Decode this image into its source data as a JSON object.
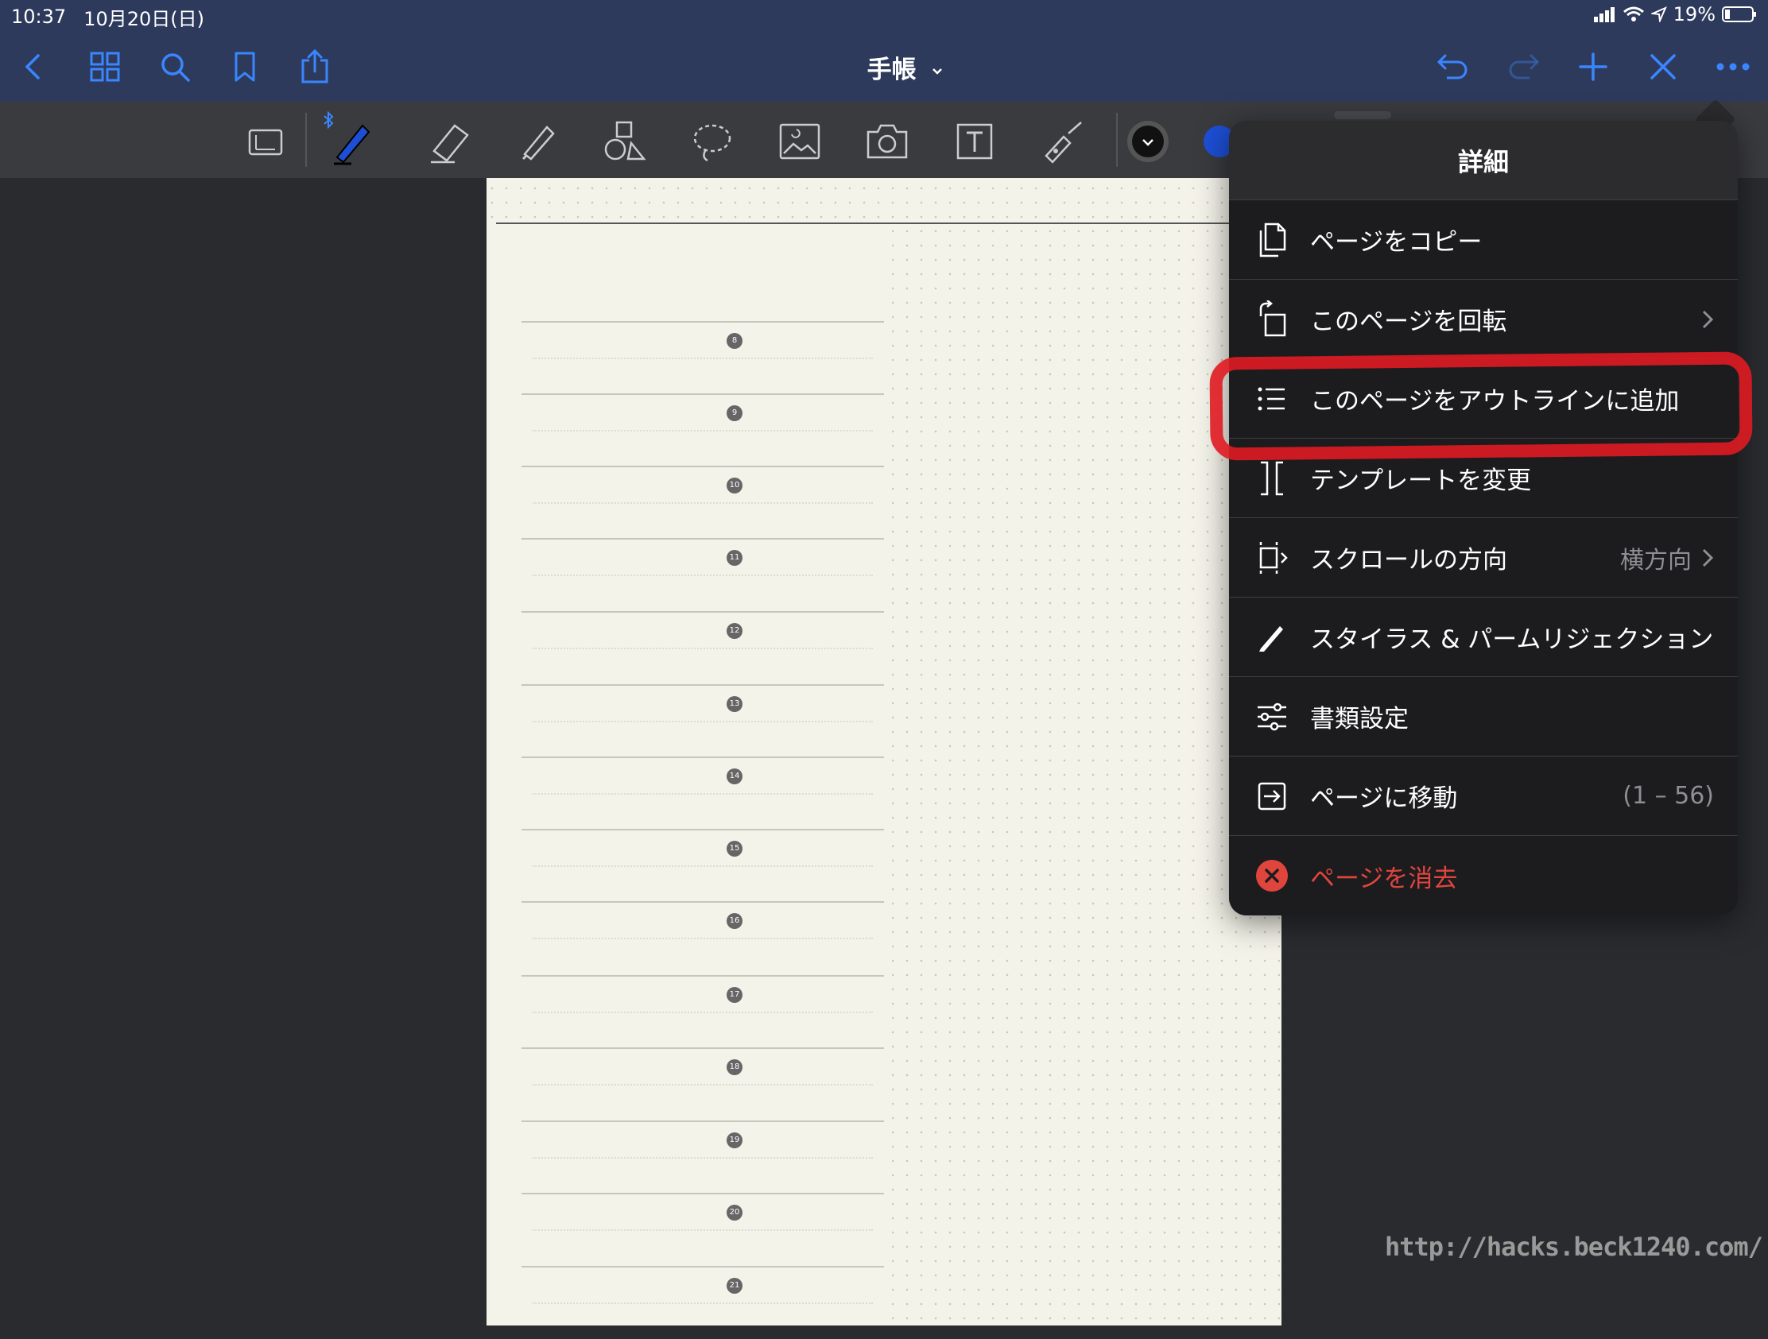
{
  "status": {
    "time": "10:37",
    "date": "10月20日(日)",
    "battery": "19%"
  },
  "topbar": {
    "title": "手帳",
    "accent": "#3a86ff"
  },
  "page": {
    "hours": [
      "8",
      "9",
      "10",
      "11",
      "12",
      "13",
      "14",
      "15",
      "16",
      "17",
      "18",
      "19",
      "20",
      "21"
    ]
  },
  "popover": {
    "title": "詳細",
    "items": [
      {
        "label": "ページをコピー",
        "icon": "copy-icon"
      },
      {
        "label": "このページを回転",
        "icon": "rotate-icon",
        "chevron": true
      },
      {
        "label": "このページをアウトラインに追加",
        "icon": "outline-list-icon"
      },
      {
        "label": "テンプレートを変更",
        "icon": "template-icon"
      },
      {
        "label": "スクロールの方向",
        "icon": "scroll-direction-icon",
        "value": "横方向",
        "chevron": true
      },
      {
        "label": "スタイラス & パームリジェクション",
        "icon": "pencil-icon"
      },
      {
        "label": "書類設定",
        "icon": "sliders-icon"
      },
      {
        "label": "ページに移動",
        "icon": "go-to-page-icon",
        "value": "(1 – 56)"
      },
      {
        "label": "ページを消去",
        "icon": "delete-icon",
        "destructive": true
      }
    ]
  },
  "watermark": "http://hacks.beck1240.com/",
  "colors": {
    "destructive": "#e0453d",
    "annotation": "#e01b22",
    "pen_blue": "#1d4fd6"
  }
}
